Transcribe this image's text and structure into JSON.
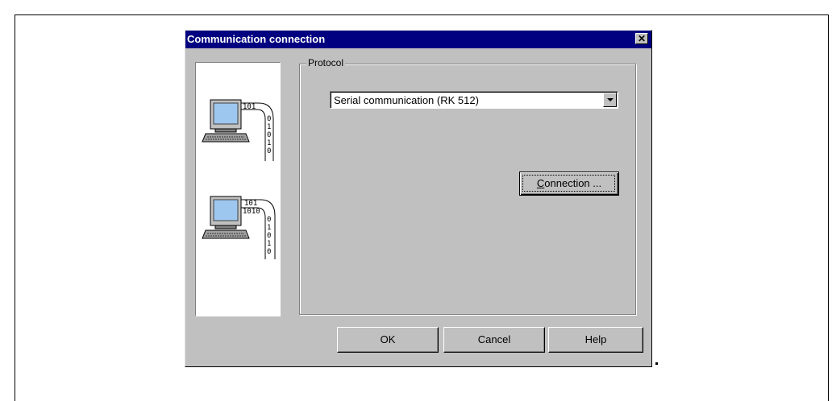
{
  "dialog": {
    "title": "Communication connection",
    "close_symbol": "✕"
  },
  "illustration": {
    "icons": [
      "computer-icon",
      "computer-icon"
    ],
    "binary_text_1": [
      "101",
      "0",
      "1",
      "0",
      "1",
      "0"
    ],
    "binary_text_2": [
      "101",
      "1010",
      "0",
      "1",
      "0",
      "1",
      "0"
    ]
  },
  "protocol": {
    "group_label": "Protocol",
    "selected_value": "Serial communication (RK 512)"
  },
  "buttons": {
    "connection_mnemonic": "C",
    "connection_rest": "onnection ...",
    "ok": "OK",
    "cancel": "Cancel",
    "help": "Help"
  },
  "colors": {
    "titlebar": "#000080",
    "dialog_bg": "#c0c0c0",
    "screen": "#9ec7f0"
  }
}
